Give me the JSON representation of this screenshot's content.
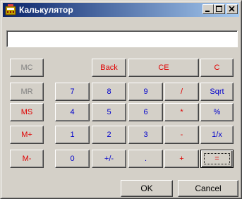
{
  "window": {
    "title": "Калькулятор",
    "icon": "calculator-app-icon",
    "minimize_icon": "minimize-icon",
    "maximize_icon": "maximize-icon",
    "close_icon": "close-icon"
  },
  "display": {
    "value": ""
  },
  "buttons": {
    "mc": "MC",
    "mr": "MR",
    "ms": "MS",
    "mplus": "M+",
    "mminus": "M-",
    "back": "Back",
    "ce": "CE",
    "c": "C",
    "n7": "7",
    "n8": "8",
    "n9": "9",
    "div": "/",
    "sqrt": "Sqrt",
    "n4": "4",
    "n5": "5",
    "n6": "6",
    "mul": "*",
    "pct": "%",
    "n1": "1",
    "n2": "2",
    "n3": "3",
    "sub": "-",
    "inv": "1/x",
    "n0": "0",
    "sign": "+/-",
    "dot": ".",
    "add": "+",
    "eq": "="
  },
  "footer": {
    "ok": "OK",
    "cancel": "Cancel"
  },
  "colors": {
    "title_start": "#0a246a",
    "title_end": "#a6caf0",
    "red": "#e00000",
    "blue": "#0000cc",
    "face": "#d4d0c8"
  }
}
